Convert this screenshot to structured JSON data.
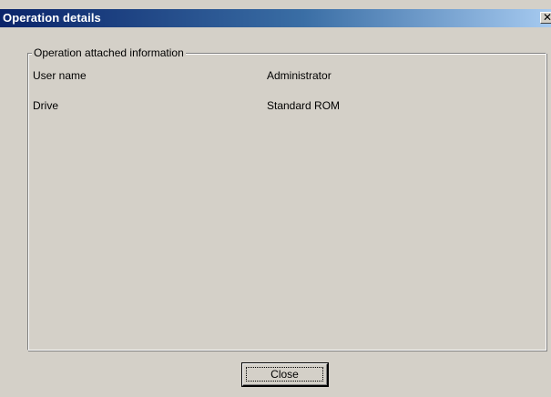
{
  "window": {
    "title": "Operation details",
    "close_glyph": "✕",
    "close_icon": "close-icon"
  },
  "group": {
    "legend": "Operation attached information",
    "rows": [
      {
        "label": "User name",
        "value": "Administrator"
      },
      {
        "label": "Drive",
        "value": "Standard ROM"
      }
    ]
  },
  "buttons": {
    "close_label": "Close"
  },
  "colors": {
    "face": "#d4d0c8",
    "title_start": "#0a246a",
    "title_end": "#a6caf0"
  }
}
